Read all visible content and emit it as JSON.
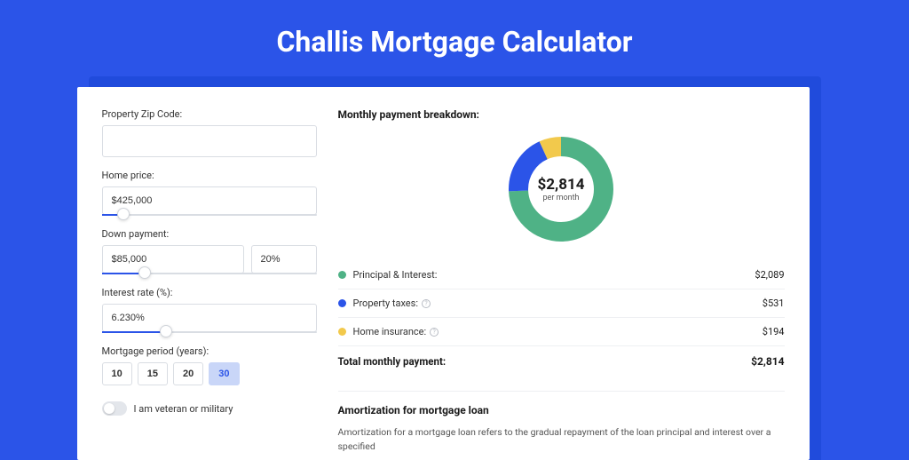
{
  "page_title": "Challis Mortgage Calculator",
  "form": {
    "zip_label": "Property Zip Code:",
    "zip_value": "",
    "home_price_label": "Home price:",
    "home_price_value": "$425,000",
    "down_payment_label": "Down payment:",
    "down_payment_value": "$85,000",
    "down_payment_pct": "20%",
    "interest_label": "Interest rate (%):",
    "interest_value": "6.230%",
    "period_label": "Mortgage period (years):",
    "period_options": [
      "10",
      "15",
      "20",
      "30"
    ],
    "period_selected": "30",
    "veteran_label": "I am veteran or military",
    "veteran_on": false
  },
  "breakdown": {
    "title": "Monthly payment breakdown:",
    "total_amount": "$2,814",
    "total_sub": "per month",
    "items": [
      {
        "label": "Principal & Interest:",
        "value": "$2,089",
        "color": "green",
        "info": false
      },
      {
        "label": "Property taxes:",
        "value": "$531",
        "color": "blue",
        "info": true
      },
      {
        "label": "Home insurance:",
        "value": "$194",
        "color": "yellow",
        "info": true
      }
    ],
    "total_label": "Total monthly payment:",
    "total_value": "$2,814"
  },
  "amortization": {
    "title": "Amortization for mortgage loan",
    "text": "Amortization for a mortgage loan refers to the gradual repayment of the loan principal and interest over a specified"
  },
  "chart_data": {
    "type": "pie",
    "title": "Monthly payment breakdown",
    "series": [
      {
        "name": "Principal & Interest",
        "value": 2089,
        "color": "#4fb286"
      },
      {
        "name": "Property taxes",
        "value": 531,
        "color": "#2b54e8"
      },
      {
        "name": "Home insurance",
        "value": 194,
        "color": "#f2c94c"
      }
    ],
    "total": 2814,
    "center_label": "$2,814",
    "center_sub": "per month"
  }
}
